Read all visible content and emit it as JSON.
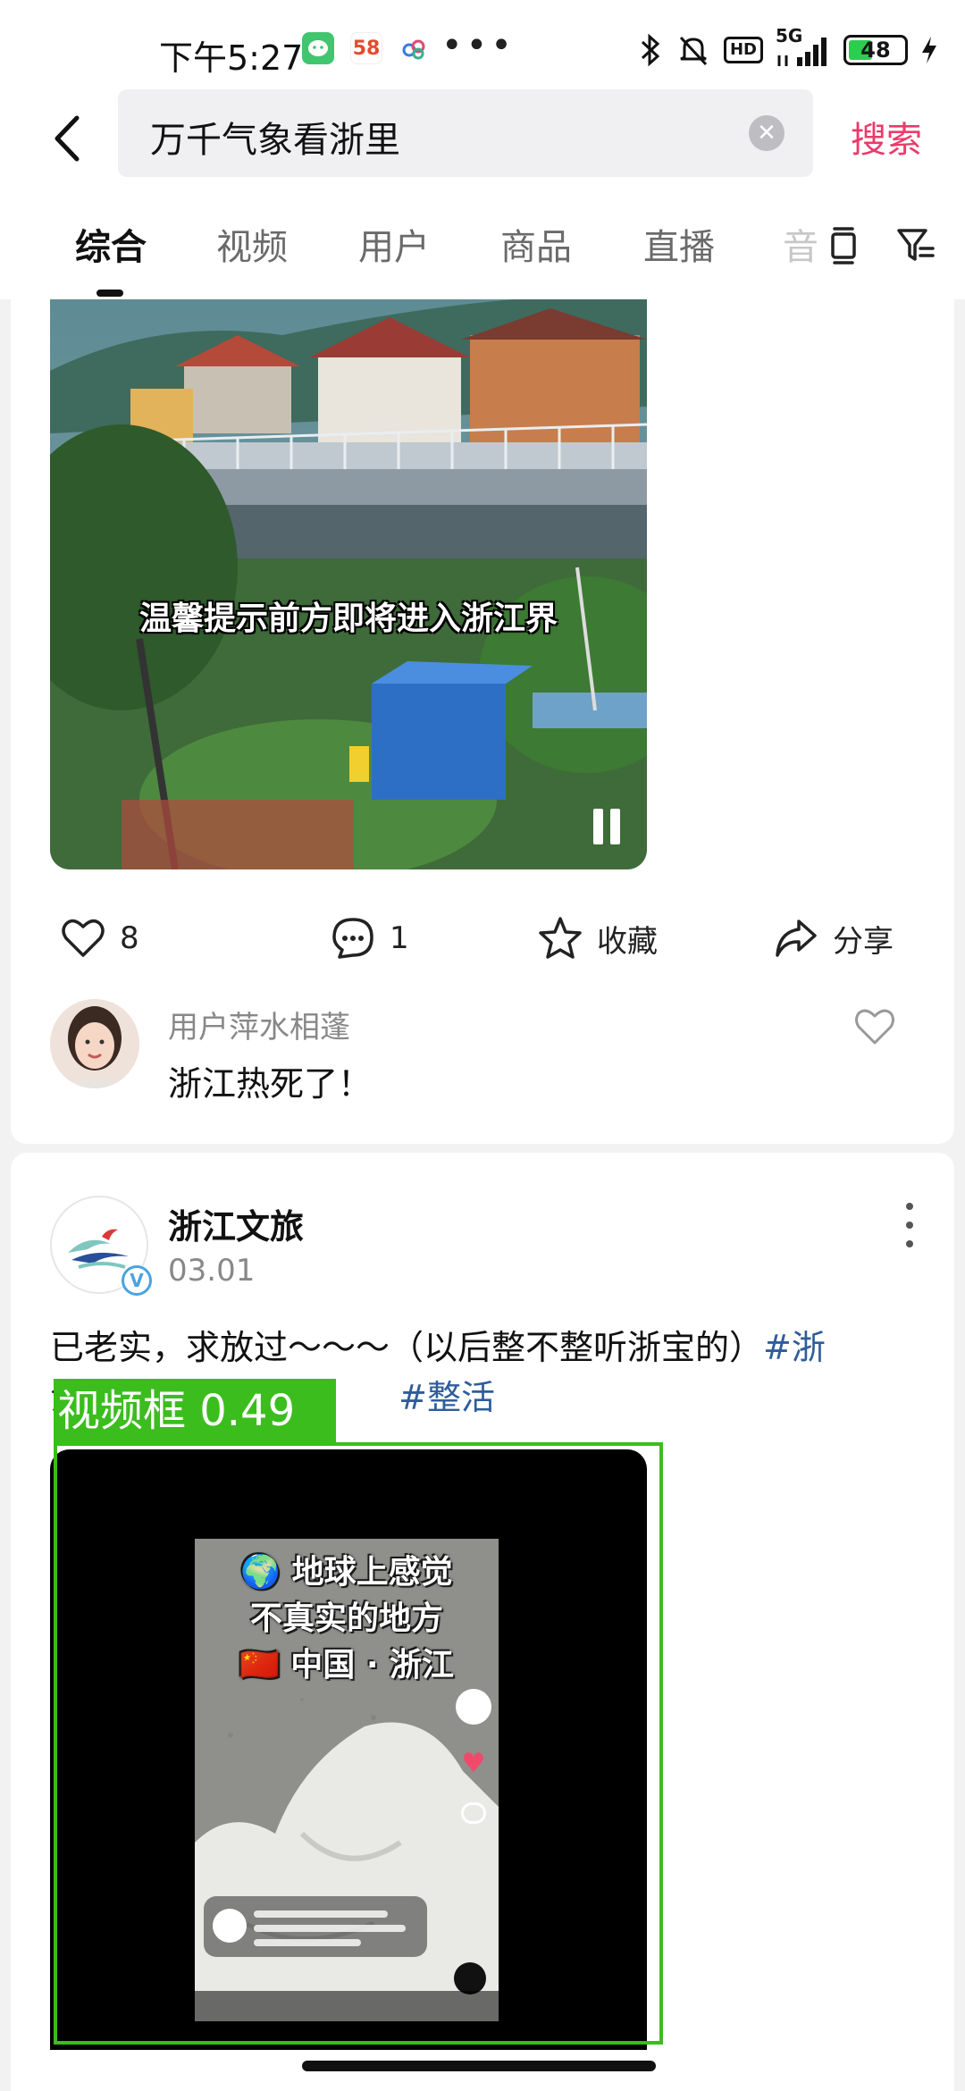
{
  "status_bar": {
    "time": "下午5:27",
    "app_badge_58": "58",
    "network": "5G",
    "battery": "48"
  },
  "search": {
    "query": "万千气象看浙里",
    "submit_label": "搜索"
  },
  "tabs": {
    "items": [
      {
        "label": "综合"
      },
      {
        "label": "视频"
      },
      {
        "label": "用户"
      },
      {
        "label": "商品"
      },
      {
        "label": "直播"
      }
    ],
    "faded": "音"
  },
  "post1": {
    "video_caption": "温馨提示前方即将进入浙江界",
    "like_count": "8",
    "comment_count": "1",
    "favorite_label": "收藏",
    "share_label": "分享",
    "comment": {
      "user": "用户萍水相蓬",
      "text": "浙江热死了！"
    }
  },
  "post2": {
    "author": "浙江文旅",
    "date": "03.01",
    "text_line1": "已老实，求放过～～～（以后整不整听浙宝的）",
    "tag1": "#浙",
    "text_line2_prefix": "江",
    "tag2": "#整活",
    "video_title_line1": "🌍 地球上感觉",
    "video_title_line2": "不真实的地方",
    "video_title_line3": "🇨🇳 中国 · 浙江"
  },
  "detection": {
    "label": "视频框 0.49"
  },
  "colors": {
    "accent": "#ea3b6a",
    "tag": "#2f5d9b",
    "detection": "#3bbd1e"
  }
}
